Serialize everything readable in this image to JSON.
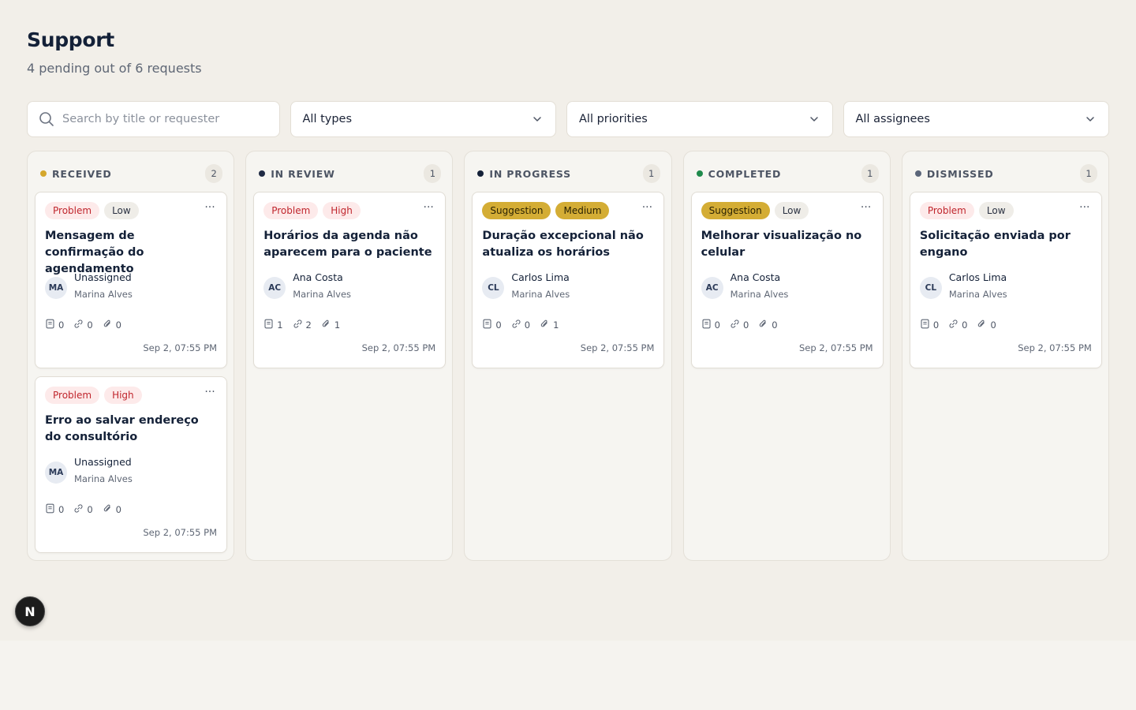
{
  "header": {
    "title": "Support",
    "subtitle": "4 pending out of 6 requests"
  },
  "filters": {
    "search_placeholder": "Search by title or requester",
    "search_value": "",
    "type": "All types",
    "priority": "All priorities",
    "assignee": "All assignees"
  },
  "colors": {
    "received": "#d4a72c",
    "in_review": "#1f2a44",
    "in_progress": "#142138",
    "completed": "#1f8a4c",
    "dismissed": "#5b667a"
  },
  "columns": [
    {
      "title": "RECEIVED",
      "count": "2",
      "cards": [
        {
          "type": "Problem",
          "priority": "Low",
          "title": "Mensagem de confirmação do agendamento",
          "initials": "MA",
          "assignee": "Unassigned",
          "requester": "Marina Alves",
          "notes": "0",
          "links": "0",
          "attachments": "0",
          "date": "Sep 2, 07:55 PM"
        },
        {
          "type": "Problem",
          "priority": "High",
          "title": "Erro ao salvar endereço do consultório",
          "initials": "MA",
          "assignee": "Unassigned",
          "requester": "Marina Alves",
          "notes": "0",
          "links": "0",
          "attachments": "0",
          "date": "Sep 2, 07:55 PM"
        }
      ]
    },
    {
      "title": "IN REVIEW",
      "count": "1",
      "cards": [
        {
          "type": "Problem",
          "priority": "High",
          "title": "Horários da agenda não aparecem para o paciente",
          "initials": "AC",
          "assignee": "Ana Costa",
          "requester": "Marina Alves",
          "notes": "1",
          "links": "2",
          "attachments": "1",
          "date": "Sep 2, 07:55 PM"
        }
      ]
    },
    {
      "title": "IN PROGRESS",
      "count": "1",
      "cards": [
        {
          "type": "Suggestion",
          "priority": "Medium",
          "title": "Duração excepcional não atualiza os horários",
          "initials": "CL",
          "assignee": "Carlos Lima",
          "requester": "Marina Alves",
          "notes": "0",
          "links": "0",
          "attachments": "1",
          "date": "Sep 2, 07:55 PM"
        }
      ]
    },
    {
      "title": "COMPLETED",
      "count": "1",
      "cards": [
        {
          "type": "Suggestion",
          "priority": "Low",
          "title": "Melhorar visualização no celular",
          "initials": "AC",
          "assignee": "Ana Costa",
          "requester": "Marina Alves",
          "notes": "0",
          "links": "0",
          "attachments": "0",
          "date": "Sep 2, 07:55 PM"
        }
      ]
    },
    {
      "title": "DISMISSED",
      "count": "1",
      "cards": [
        {
          "type": "Problem",
          "priority": "Low",
          "title": "Solicitação enviada por engano",
          "initials": "CL",
          "assignee": "Carlos Lima",
          "requester": "Marina Alves",
          "notes": "0",
          "links": "0",
          "attachments": "0",
          "date": "Sep 2, 07:55 PM"
        }
      ]
    }
  ],
  "fab": {
    "label": "N"
  }
}
